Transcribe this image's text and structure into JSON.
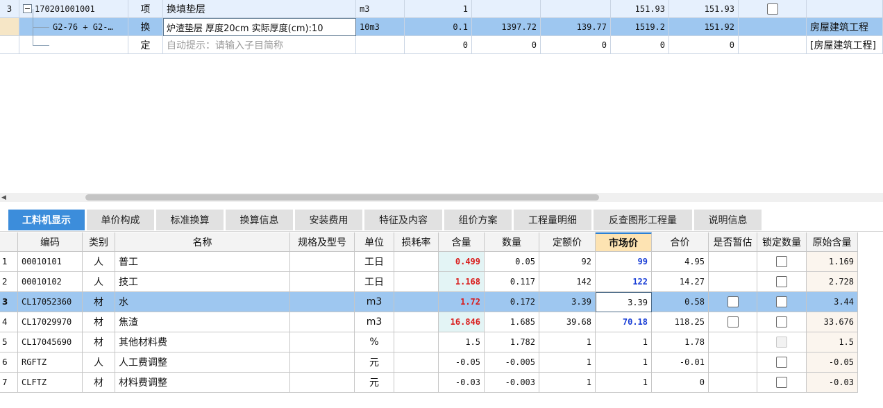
{
  "top_rows": [
    {
      "row_no": "3",
      "expander": "−",
      "code": "170201001001",
      "type": "项",
      "name": "换填垫层",
      "unit": "m3",
      "qty": "1",
      "base_price": "",
      "unit_price": "",
      "total1": "151.93",
      "total2": "151.93",
      "has_checkbox": true,
      "profession": ""
    },
    {
      "row_no": "",
      "code": "G2-76 + G2-…",
      "type": "换",
      "name": "炉渣垫层 厚度20cm  实际厚度(cm):10",
      "unit": "10m3",
      "qty": "0.1",
      "base_price": "1397.72",
      "unit_price": "139.77",
      "total1": "1519.2",
      "total2": "151.92",
      "has_checkbox": false,
      "profession": "房屋建筑工程"
    },
    {
      "row_no": "",
      "code": "",
      "type": "定",
      "name": "自动提示：请输入子目简称",
      "unit": "",
      "qty": "0",
      "base_price": "0",
      "unit_price": "0",
      "total1": "0",
      "total2": "0",
      "has_checkbox": false,
      "profession": "[房屋建筑工程]"
    }
  ],
  "tabs": [
    "工料机显示",
    "单价构成",
    "标准换算",
    "换算信息",
    "安装费用",
    "特征及内容",
    "组价方案",
    "工程量明细",
    "反查图形工程量",
    "说明信息"
  ],
  "columns": [
    "编码",
    "类别",
    "名称",
    "规格及型号",
    "单位",
    "损耗率",
    "含量",
    "数量",
    "定额价",
    "市场价",
    "合价",
    "是否暂估",
    "锁定数量",
    "原始含量"
  ],
  "rows": [
    {
      "no": "1",
      "code": "00010101",
      "cat": "人",
      "name": "普工",
      "spec": "",
      "unit": "工日",
      "loss": "",
      "content": "0.499",
      "qty": "0.05",
      "base": "92",
      "market": "99",
      "total": "4.95",
      "est": "none",
      "lock": "box",
      "orig": "1.169"
    },
    {
      "no": "2",
      "code": "00010102",
      "cat": "人",
      "name": "技工",
      "spec": "",
      "unit": "工日",
      "loss": "",
      "content": "1.168",
      "qty": "0.117",
      "base": "142",
      "market": "122",
      "total": "14.27",
      "est": "none",
      "lock": "box",
      "orig": "2.728"
    },
    {
      "no": "3",
      "code": "CL17052360",
      "cat": "材",
      "name": "水",
      "spec": "",
      "unit": "m3",
      "loss": "",
      "content": "1.72",
      "qty": "0.172",
      "base": "3.39",
      "market": "3.39",
      "total": "0.58",
      "est": "box",
      "lock": "box",
      "orig": "3.44"
    },
    {
      "no": "4",
      "code": "CL17029970",
      "cat": "材",
      "name": "焦渣",
      "spec": "",
      "unit": "m3",
      "loss": "",
      "content": "16.846",
      "qty": "1.685",
      "base": "39.68",
      "market": "70.18",
      "total": "118.25",
      "est": "box",
      "lock": "box",
      "orig": "33.676"
    },
    {
      "no": "5",
      "code": "CL17045690",
      "cat": "材",
      "name": "其他材料费",
      "spec": "",
      "unit": "%",
      "loss": "",
      "content": "1.5",
      "qty": "1.782",
      "base": "1",
      "market": "1",
      "total": "1.78",
      "est": "none",
      "lock": "disabled",
      "orig": "1.5"
    },
    {
      "no": "6",
      "code": "RGFTZ",
      "cat": "人",
      "name": "人工费调整",
      "spec": "",
      "unit": "元",
      "loss": "",
      "content": "-0.05",
      "qty": "-0.005",
      "base": "1",
      "market": "1",
      "total": "-0.01",
      "est": "none",
      "lock": "box",
      "orig": "-0.05"
    },
    {
      "no": "7",
      "code": "CLFTZ",
      "cat": "材",
      "name": "材料费调整",
      "spec": "",
      "unit": "元",
      "loss": "",
      "content": "-0.03",
      "qty": "-0.003",
      "base": "1",
      "market": "1",
      "total": "0",
      "est": "none",
      "lock": "box",
      "orig": "-0.03"
    }
  ],
  "selected_row_index": 2,
  "highlight_columns": {
    "content": [
      0,
      1,
      2,
      3
    ],
    "market": [
      0,
      1,
      3
    ]
  },
  "colors": {
    "content_red": "#d91b1b",
    "market_blue": "#1a3fd6",
    "selection": "#9ec7f0",
    "tab_active": "#3c8ddb"
  }
}
